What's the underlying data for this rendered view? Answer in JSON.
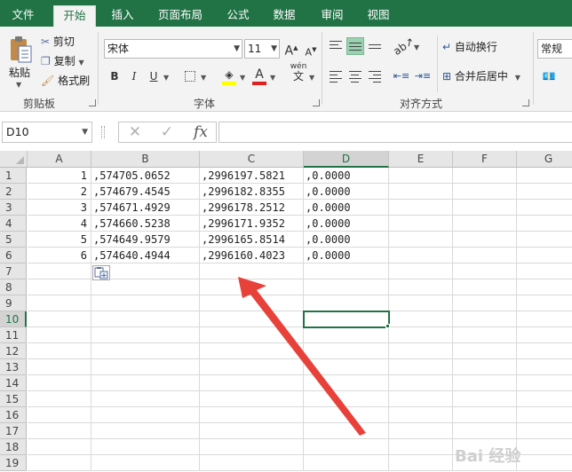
{
  "tabs": [
    {
      "label": "文件"
    },
    {
      "label": "开始"
    },
    {
      "label": "插入"
    },
    {
      "label": "页面布局"
    },
    {
      "label": "公式"
    },
    {
      "label": "数据"
    },
    {
      "label": "审阅"
    },
    {
      "label": "视图"
    }
  ],
  "ribbon": {
    "clipboard": {
      "label": "剪贴板",
      "paste": "粘贴",
      "cut": "剪切",
      "copy": "复制",
      "format_painter": "格式刷"
    },
    "font": {
      "label": "字体",
      "name": "宋体",
      "size": "11",
      "bold": "B",
      "italic": "I",
      "underline": "U",
      "grow": "A",
      "shrink": "A",
      "wen": "wén",
      "wen_char": "文"
    },
    "alignment": {
      "label": "对齐方式",
      "wrap_text": "自动换行",
      "merge_center": "合并后居中"
    },
    "number": {
      "format": "常规"
    }
  },
  "formula_bar": {
    "name_box": "D10",
    "cancel": "✕",
    "enter": "✓",
    "fx": "fx",
    "content": ""
  },
  "columns": [
    "A",
    "B",
    "C",
    "D",
    "E",
    "F",
    "G"
  ],
  "rows": [
    "1",
    "2",
    "3",
    "4",
    "5",
    "6",
    "7",
    "8",
    "9",
    "10",
    "11",
    "12",
    "13",
    "14",
    "15",
    "16",
    "17",
    "18",
    "19"
  ],
  "cells": [
    [
      "1",
      ",574705.0652",
      ",2996197.5821",
      ",0.0000"
    ],
    [
      "2",
      ",574679.4545",
      ",2996182.8355",
      ",0.0000"
    ],
    [
      "3",
      ",574671.4929",
      ",2996178.2512",
      ",0.0000"
    ],
    [
      "4",
      ",574660.5238",
      ",2996171.9352",
      ",0.0000"
    ],
    [
      "5",
      ",574649.9579",
      ",2996165.8514",
      ",0.0000"
    ],
    [
      "6",
      ",574640.4944",
      ",2996160.4023",
      ",0.0000"
    ]
  ],
  "active_cell": "D10",
  "colors": {
    "brand": "#217346",
    "arrow": "#e8413a",
    "selected_button": "#9ad1b1"
  },
  "watermark": "Bai 经验"
}
